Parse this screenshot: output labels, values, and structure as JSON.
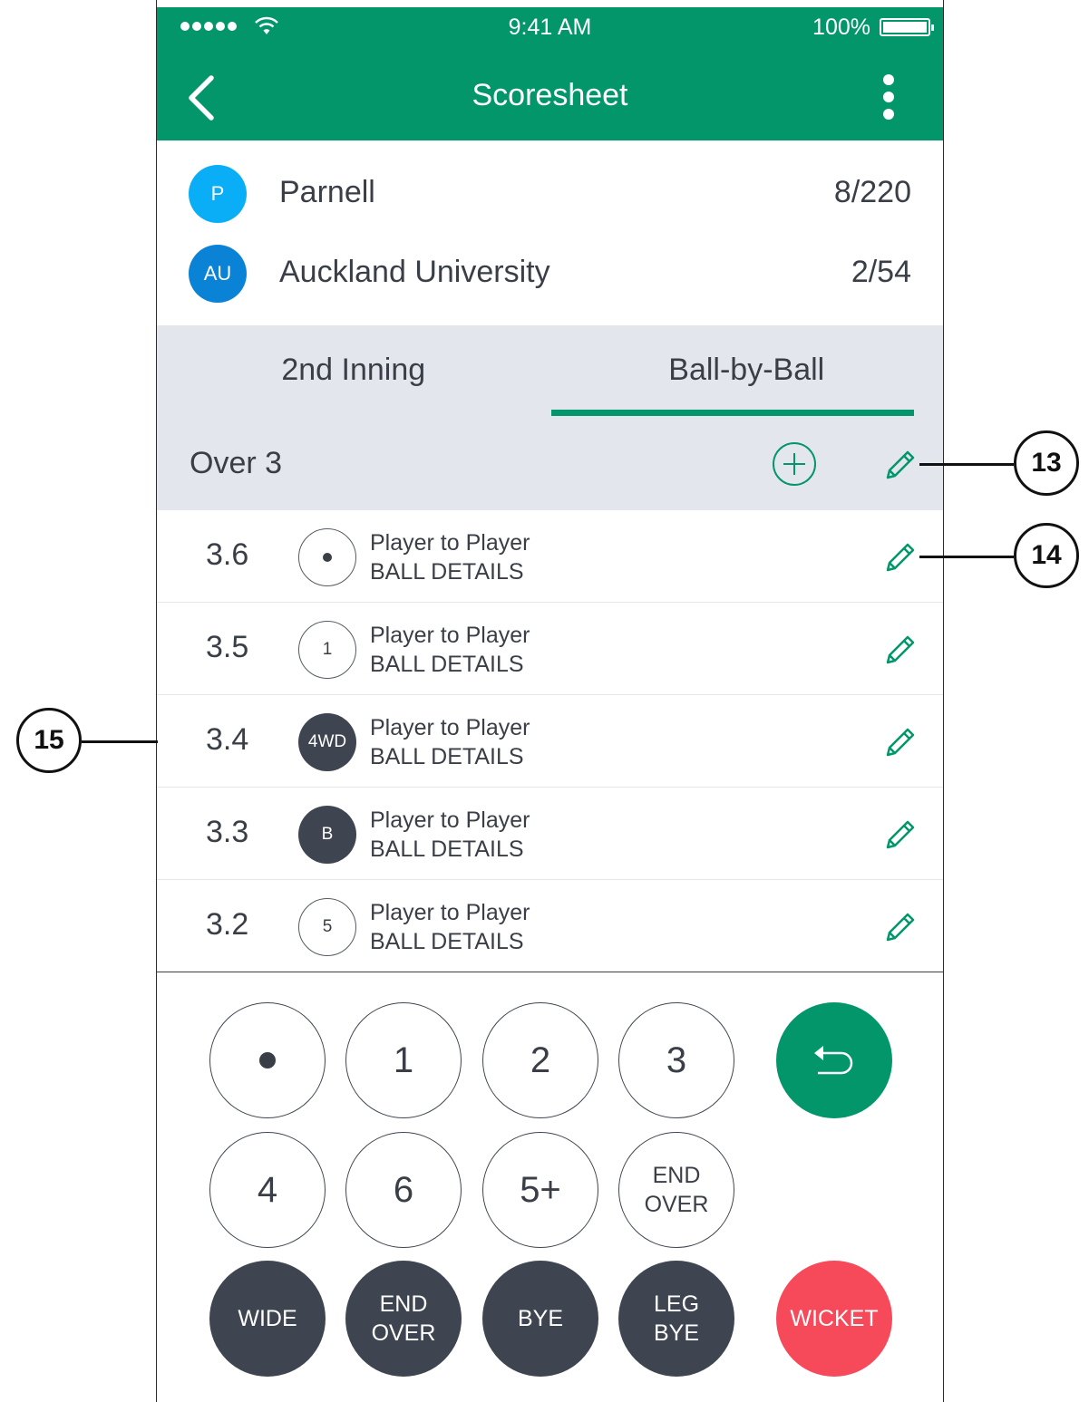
{
  "status_bar": {
    "time": "9:41 AM",
    "battery": "100%"
  },
  "header": {
    "title": "Scoresheet",
    "back_icon": "chevron-left-icon",
    "menu_icon": "vertical-ellipsis-icon"
  },
  "teams": [
    {
      "initials": "P",
      "name": "Parnell",
      "score": "8/220",
      "color": "#0aaef7"
    },
    {
      "initials": "AU",
      "name": "Auckland University",
      "score": "2/54",
      "color": "#0a83d6"
    }
  ],
  "tabs": [
    {
      "label": "2nd Inning",
      "active": false
    },
    {
      "label": "Ball-by-Ball",
      "active": true
    }
  ],
  "over": {
    "title": "Over 3",
    "add_icon": "plus-circle-icon",
    "edit_icon": "pencil-icon"
  },
  "balls": [
    {
      "number": "3.6",
      "badge": "•",
      "style": "outline",
      "players": "Player to Player",
      "details": "BALL DETAILS"
    },
    {
      "number": "3.5",
      "badge": "1",
      "style": "outline",
      "players": "Player to Player",
      "details": "BALL DETAILS"
    },
    {
      "number": "3.4",
      "badge": "4WD",
      "style": "filled",
      "players": "Player to Player",
      "details": "BALL DETAILS"
    },
    {
      "number": "3.3",
      "badge": "B",
      "style": "filled",
      "players": "Player to Player",
      "details": "BALL DETAILS"
    },
    {
      "number": "3.2",
      "badge": "5",
      "style": "outline",
      "players": "Player to Player",
      "details": "BALL DETAILS"
    }
  ],
  "keypad": {
    "one": "1",
    "two": "2",
    "three": "3",
    "four": "4",
    "six": "6",
    "five_plus": "5+",
    "end_over_1": "END",
    "end_over_2": "OVER",
    "wide": "WIDE",
    "end_over_dark_1": "END",
    "end_over_dark_2": "OVER",
    "bye": "BYE",
    "leg_bye_1": "LEG",
    "leg_bye_2": "BYE",
    "wicket": "WICKET",
    "undo_icon": "undo-arrow-icon",
    "dot_icon": "dot-ball-icon"
  },
  "callouts": [
    "13",
    "14",
    "15"
  ],
  "colors": {
    "primary": "#03966b",
    "danger": "#f64a5a",
    "dark": "#3f4550",
    "tab_bg": "#e3e6ed"
  }
}
